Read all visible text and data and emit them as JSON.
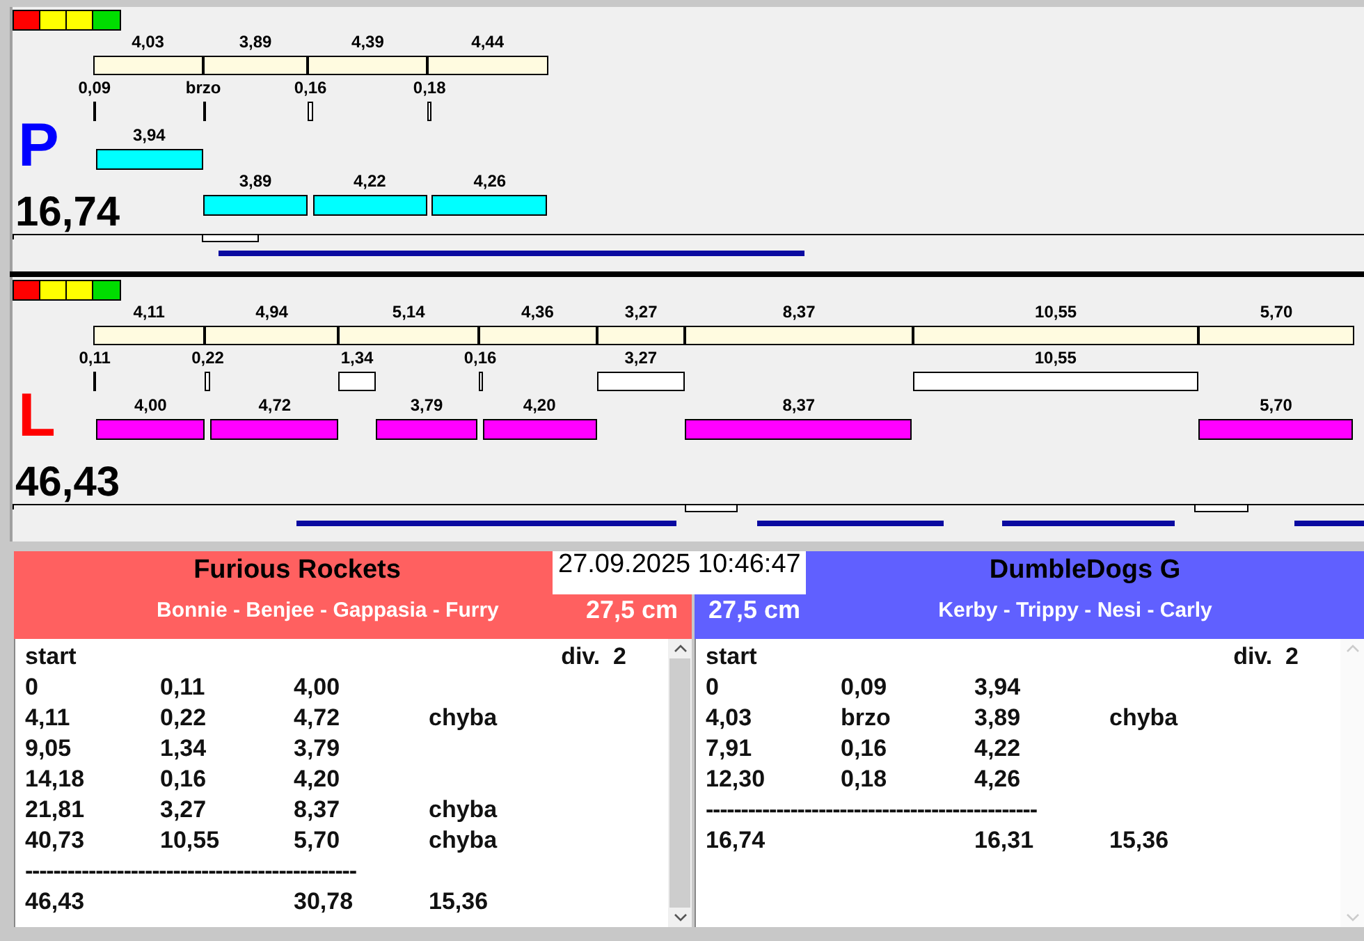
{
  "lanes": [
    {
      "letter": "P",
      "color": "#0000ff",
      "total": "16,74",
      "segments": [
        {
          "label": "4,03"
        },
        {
          "label": "3,89"
        },
        {
          "label": "4,39"
        },
        {
          "label": "4,44"
        }
      ],
      "heats": [
        {
          "gap": "0,09",
          "run": "3,94",
          "kind": "upper",
          "color": "#00ffff"
        },
        {
          "gap": "brzo",
          "run": "3,89",
          "kind": "lower",
          "color": "#00ffff"
        },
        {
          "gap": "0,16",
          "run": "4,22",
          "kind": "lower",
          "color": "#00ffff"
        },
        {
          "gap": "0,18",
          "run": "4,26",
          "kind": "lower",
          "color": "#00ffff"
        }
      ]
    },
    {
      "letter": "L",
      "color": "#ff0000",
      "total": "46,43",
      "segments": [
        {
          "label": "4,11"
        },
        {
          "label": "4,94"
        },
        {
          "label": "5,14"
        },
        {
          "label": "4,36"
        },
        {
          "label": "3,27"
        },
        {
          "label": "8,37"
        },
        {
          "label": "10,55"
        },
        {
          "label": "5,70"
        }
      ],
      "heats": [
        {
          "gap": "0,11",
          "run": "4,00",
          "kind": "upper",
          "color": "#ff00ff"
        },
        {
          "gap": "0,22",
          "run": "4,72",
          "kind": "upper",
          "color": "#ff00ff"
        },
        {
          "gap": "1,34",
          "run": "3,79",
          "kind": "upper",
          "color": "#ff00ff"
        },
        {
          "gap": "0,16",
          "run": "4,20",
          "kind": "upper",
          "color": "#ff00ff"
        },
        {
          "gap": "3,27",
          "run": "8,37",
          "kind": "upper",
          "color": "#ff00ff"
        },
        {
          "gap": "10,55",
          "run": "5,70",
          "kind": "upper",
          "color": "#ff00ff"
        }
      ]
    }
  ],
  "timestamp": "27.09.2025 10:46:47",
  "teams": [
    {
      "name": "Furious Rockets",
      "dogs": "Bonnie - Benjee - Gappasia - Furry",
      "distance": "27,5 cm",
      "color": "#ff6060",
      "start_label": "start",
      "division": "div.  2",
      "scrollable": true,
      "rows": [
        {
          "start": "0",
          "gap": "0,11",
          "run": "4,00"
        },
        {
          "start": "4,11",
          "gap": "0,22",
          "run": "4,72",
          "note": "chyba"
        },
        {
          "start": "9,05",
          "gap": "1,34",
          "run": "3,79"
        },
        {
          "start": "14,18",
          "gap": "0,16",
          "run": "4,20"
        },
        {
          "start": "21,81",
          "gap": "3,27",
          "run": "8,37",
          "note": "chyba"
        },
        {
          "start": "40,73",
          "gap": "10,55",
          "run": "5,70",
          "note": "chyba"
        }
      ],
      "separator": "-----------------------------------------------",
      "totals": {
        "time": "46,43",
        "sum": "30,78",
        "best": "15,36"
      }
    },
    {
      "name": "DumbleDogs G",
      "dogs": "Kerby - Trippy - Nesi - Carly",
      "distance": "27,5 cm",
      "color": "#6060ff",
      "start_label": "start",
      "division": "div.  2",
      "scrollable": false,
      "rows": [
        {
          "start": "0",
          "gap": "0,09",
          "run": "3,94"
        },
        {
          "start": "4,03",
          "gap": "brzo",
          "run": "3,89",
          "note": "chyba"
        },
        {
          "start": "7,91",
          "gap": "0,16",
          "run": "4,22"
        },
        {
          "start": "12,30",
          "gap": "0,18",
          "run": "4,26"
        }
      ],
      "separator": "-----------------------------------------------",
      "totals": {
        "time": "16,74",
        "sum": "16,31",
        "best": "15,36"
      }
    }
  ]
}
